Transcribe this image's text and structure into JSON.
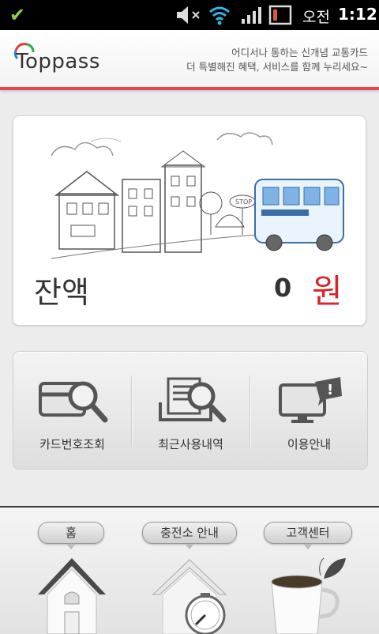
{
  "status_bar": {
    "time_prefix": "오전",
    "time": "1:12",
    "icons": [
      "checkmark-icon",
      "mute-icon",
      "wifi-icon",
      "signal-icon",
      "battery-icon"
    ]
  },
  "header": {
    "logo": "Toppass",
    "tagline_line1": "어디서나 통하는 신개념 교통카드",
    "tagline_line2": "더 특별해진 혜택, 서비스를 함께 누리세요~",
    "accent_color": "#e8454f"
  },
  "balance": {
    "label": "잔액",
    "value": "0",
    "unit": "원",
    "unit_color": "#d8232a"
  },
  "menu": {
    "items": [
      {
        "label": "카드번호조회",
        "icon": "card-search-icon"
      },
      {
        "label": "최근사용내역",
        "icon": "history-search-icon"
      },
      {
        "label": "이용안내",
        "icon": "monitor-info-icon"
      }
    ]
  },
  "dock": {
    "tabs": [
      {
        "label": "홈",
        "icon": "home-icon"
      },
      {
        "label": "충전소 안내",
        "icon": "charging-station-icon"
      },
      {
        "label": "고객센터",
        "icon": "coffee-cup-icon"
      }
    ]
  }
}
